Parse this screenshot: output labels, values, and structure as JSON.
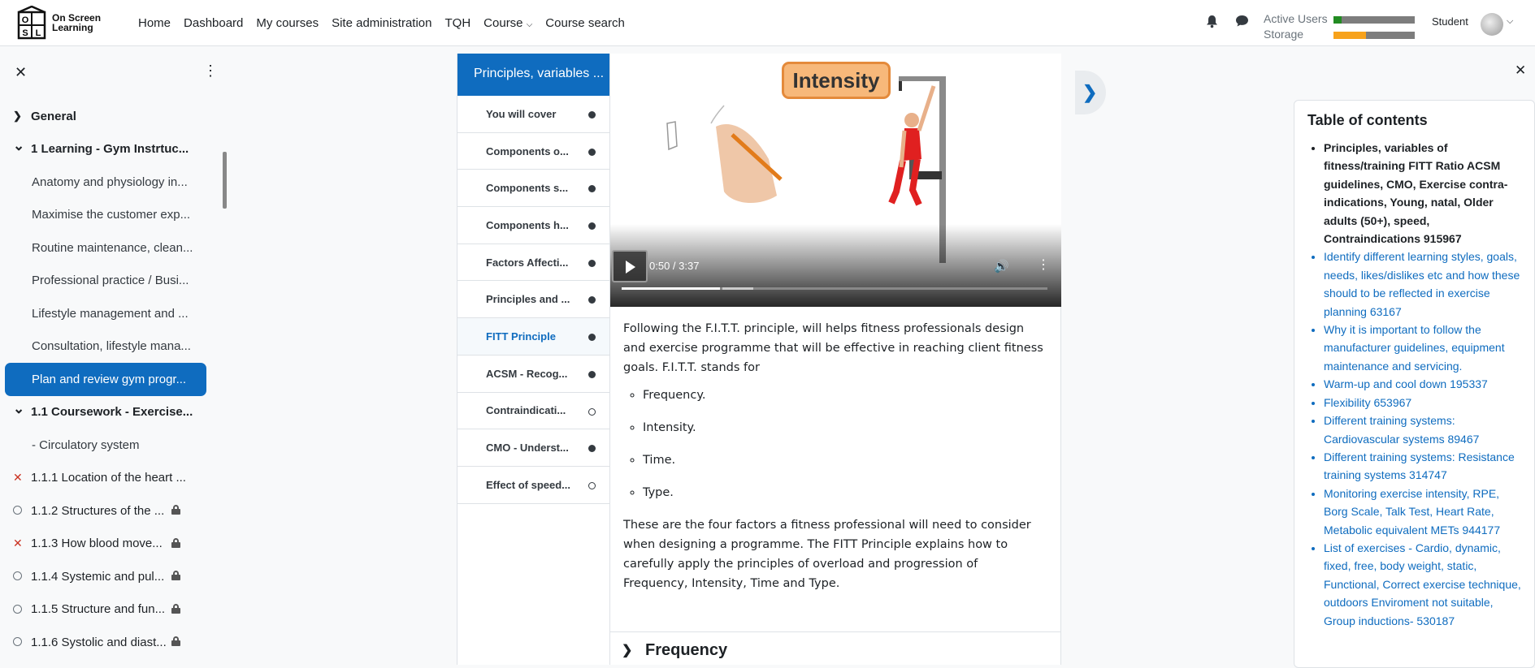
{
  "navbar": {
    "logo_text": "On Screen Learning",
    "logo_text_line1": "On Screen",
    "logo_text_line2": "Learning",
    "links": [
      "Home",
      "Dashboard",
      "My courses",
      "Site administration",
      "TQH",
      "Course",
      "Course search"
    ],
    "usage": {
      "active_users_label": "Active Users",
      "storage_label": "Storage",
      "active_users_fraction": 0.1,
      "storage_fraction": 0.4,
      "active_users_color": "#228b22",
      "storage_color": "#f7a21b"
    },
    "user_name": "Student",
    "bell_icon": "bell-icon",
    "chat_icon": "chat-bubble-icon"
  },
  "left_drawer": {
    "items": [
      {
        "label": "General",
        "type": "section",
        "chevron": "right"
      },
      {
        "label": "1 Learning - Gym Instrtuc...",
        "type": "section",
        "chevron": "down"
      },
      {
        "label": "Anatomy and physiology in...",
        "type": "sub"
      },
      {
        "label": "Maximise the customer exp...",
        "type": "sub"
      },
      {
        "label": "Routine maintenance, clean...",
        "type": "sub"
      },
      {
        "label": "Professional practice / Busi...",
        "type": "sub"
      },
      {
        "label": "Lifestyle management and ...",
        "type": "sub"
      },
      {
        "label": "Consultation, lifestyle mana...",
        "type": "sub"
      },
      {
        "label": "Plan and review gym progr...",
        "type": "active"
      },
      {
        "label": "1.1 Coursework - Exercise...",
        "type": "section",
        "chevron": "down"
      },
      {
        "label": "- Circulatory system",
        "type": "sub"
      },
      {
        "label": "1.1.1 Location of the heart ...",
        "type": "activity",
        "state": "cross"
      },
      {
        "label": "1.1.2 Structures of the ...",
        "type": "activity",
        "state": "circle",
        "locked": true
      },
      {
        "label": "1.1.3 How blood move...",
        "type": "activity",
        "state": "cross",
        "locked": true
      },
      {
        "label": "1.1.4 Systemic and pul...",
        "type": "activity",
        "state": "circle",
        "locked": true
      },
      {
        "label": "1.1.5 Structure and fun...",
        "type": "activity",
        "state": "circle",
        "locked": true
      },
      {
        "label": "1.1.6 Systolic and diast...",
        "type": "activity",
        "state": "circle",
        "locked": true
      }
    ]
  },
  "book": {
    "toc_title": "Principles, variables ...",
    "chapters": [
      {
        "label": "You will cover",
        "dot": "filled"
      },
      {
        "label": "Components o...",
        "dot": "filled"
      },
      {
        "label": "Components s...",
        "dot": "filled"
      },
      {
        "label": "Components h...",
        "dot": "filled"
      },
      {
        "label": "Factors Affecti...",
        "dot": "filled"
      },
      {
        "label": "Principles and ...",
        "dot": "filled"
      },
      {
        "label": "FITT Principle",
        "dot": "filled",
        "current": true
      },
      {
        "label": "ACSM - Recog...",
        "dot": "filled"
      },
      {
        "label": "Contraindicati...",
        "dot": "empty"
      },
      {
        "label": "CMO - Underst...",
        "dot": "filled"
      },
      {
        "label": "Effect of speed...",
        "dot": "empty"
      }
    ]
  },
  "video": {
    "badge": "Intensity",
    "time": "0:50 / 3:37",
    "progress_fraction": 0.23
  },
  "article": {
    "intro": "Following the F.I.T.T. principle, will helps fitness professionals design and exercise programme that will be effective in reaching client fitness goals. F.I.T.T. stands for",
    "bullets": [
      "Frequency.",
      "Intensity.",
      "Time.",
      "Type."
    ],
    "outro": "These are the four factors a fitness professional will need to consider when designing a programme. The FITT Principle explains how to carefully apply the principles of overload and progression of Frequency, Intensity, Time and Type.",
    "next_section": "Frequency"
  },
  "right_drawer": {
    "title": "Table of contents",
    "items": [
      {
        "label": "Principles, variables of fitness/training FITT Ratio ACSM guidelines, CMO, Exercise contra-indications, Young, natal, Older adults (50+), speed, Contraindications 915967",
        "bold": true
      },
      {
        "label": "Identify different learning styles, goals, needs, likes/dislikes etc and how these should to be reflected in exercise planning 63167"
      },
      {
        "label": "Why it is important to follow the manufacturer guidelines, equipment maintenance and servicing."
      },
      {
        "label": "Warm-up and cool down 195337"
      },
      {
        "label": "Flexibility 653967"
      },
      {
        "label": "Different training systems: Cardiovascular systems 89467"
      },
      {
        "label": "Different training systems: Resistance training systems 314747"
      },
      {
        "label": "Monitoring exercise intensity, RPE, Borg Scale, Talk Test, Heart Rate, Metabolic equivalent METs 944177"
      },
      {
        "label": "List of exercises - Cardio, dynamic, fixed, free, body weight, static, Functional, Correct exercise technique, outdoors Enviroment not suitable, Group inductions- 530187"
      }
    ]
  },
  "colors": {
    "primary": "#0f6cbf",
    "cross": "#ca3120"
  }
}
